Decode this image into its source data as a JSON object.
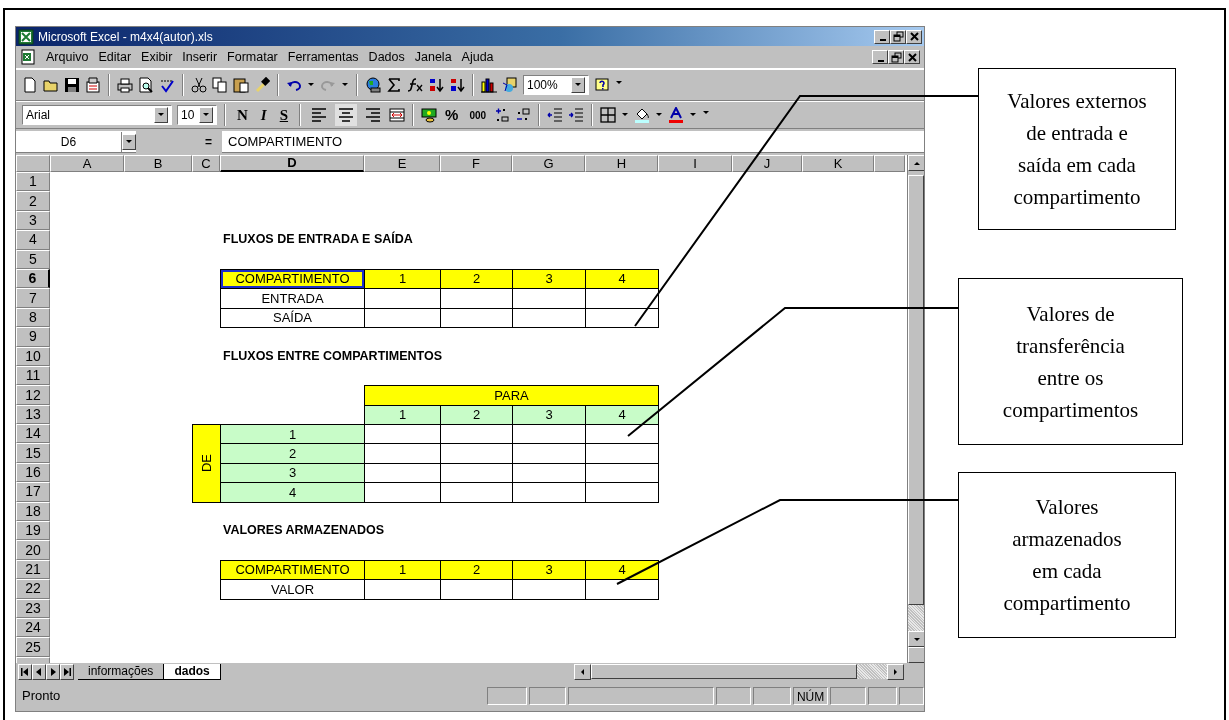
{
  "window": {
    "title": "Microsoft Excel - m4x4(autor).xls"
  },
  "menu": [
    "Arquivo",
    "Editar",
    "Exibir",
    "Inserir",
    "Formatar",
    "Ferramentas",
    "Dados",
    "Janela",
    "Ajuda"
  ],
  "standard_toolbar": {
    "zoom": "100%"
  },
  "formatting_toolbar": {
    "font": "Arial",
    "size": "10",
    "style_buttons": [
      "N",
      "I",
      "S"
    ],
    "alignment": [
      {
        "selected": false
      },
      {
        "selected": true
      },
      {
        "selected": false
      }
    ],
    "number_buttons": [
      "%",
      "000"
    ]
  },
  "formula_bar": {
    "cell": "D6",
    "equals": "=",
    "content": "COMPARTIMENTO"
  },
  "sheet": {
    "columns": [
      {
        "label": "A",
        "selected": false
      },
      {
        "label": "B",
        "selected": false
      },
      {
        "label": "C",
        "selected": false
      },
      {
        "label": "D",
        "selected": true
      },
      {
        "label": "E",
        "selected": false
      },
      {
        "label": "F",
        "selected": false
      },
      {
        "label": "G",
        "selected": false
      },
      {
        "label": "H",
        "selected": false
      },
      {
        "label": "I",
        "selected": false
      },
      {
        "label": "J",
        "selected": false
      },
      {
        "label": "K",
        "selected": false
      }
    ],
    "rows": [
      {
        "label": "1",
        "selected": false
      },
      {
        "label": "2",
        "selected": false
      },
      {
        "label": "3",
        "selected": false
      },
      {
        "label": "4",
        "selected": false
      },
      {
        "label": "5",
        "selected": false
      },
      {
        "label": "6",
        "selected": true
      },
      {
        "label": "7",
        "selected": false
      },
      {
        "label": "8",
        "selected": false
      },
      {
        "label": "9",
        "selected": false
      },
      {
        "label": "10",
        "selected": false
      },
      {
        "label": "11",
        "selected": false
      },
      {
        "label": "12",
        "selected": false
      },
      {
        "label": "13",
        "selected": false
      },
      {
        "label": "14",
        "selected": false
      },
      {
        "label": "15",
        "selected": false
      },
      {
        "label": "16",
        "selected": false
      },
      {
        "label": "17",
        "selected": false
      },
      {
        "label": "18",
        "selected": false
      },
      {
        "label": "19",
        "selected": false
      },
      {
        "label": "20",
        "selected": false
      },
      {
        "label": "21",
        "selected": false
      },
      {
        "label": "22",
        "selected": false
      },
      {
        "label": "23",
        "selected": false
      },
      {
        "label": "24",
        "selected": false
      },
      {
        "label": "25",
        "selected": false
      }
    ]
  },
  "sections": [
    {
      "kind": "simple",
      "heading": "FLUXOS DE ENTRADA E SAÍDA",
      "header": [
        {
          "text": "COMPARTIMENTO",
          "selected": true
        },
        {
          "text": "1",
          "selected": false
        },
        {
          "text": "2",
          "selected": false
        },
        {
          "text": "3",
          "selected": false
        },
        {
          "text": "4",
          "selected": false
        }
      ],
      "rows": [
        {
          "label": "ENTRADA"
        },
        {
          "label": "SAÍDA"
        }
      ]
    },
    {
      "kind": "matrix",
      "heading": "FLUXOS ENTRE COMPARTIMENTOS",
      "to_label": "PARA",
      "from_label": "DE",
      "to": [
        "1",
        "2",
        "3",
        "4"
      ],
      "from": [
        "1",
        "2",
        "3",
        "4"
      ]
    },
    {
      "kind": "simple",
      "heading": "VALORES ARMAZENADOS",
      "header": [
        {
          "text": "COMPARTIMENTO",
          "selected": false
        },
        {
          "text": "1",
          "selected": false
        },
        {
          "text": "2",
          "selected": false
        },
        {
          "text": "3",
          "selected": false
        },
        {
          "text": "4",
          "selected": false
        }
      ],
      "rows": [
        {
          "label": "VALOR"
        }
      ]
    }
  ],
  "sheet_tabs": [
    {
      "label": "informações",
      "selected": false
    },
    {
      "label": "dados",
      "selected": true
    }
  ],
  "status_bar": {
    "text": "Pronto",
    "indicators": [
      "NÚM"
    ]
  },
  "callouts": [
    "Valores externos de entrada e saída em cada compartimento",
    "Valores de transferência entre os compartimentos",
    "Valores armazenados em cada compartimento"
  ]
}
